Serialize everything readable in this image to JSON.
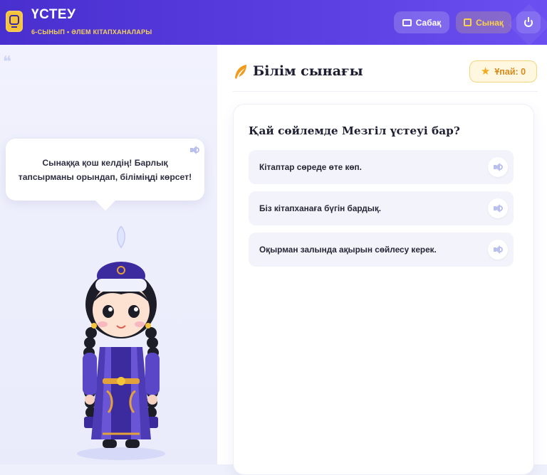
{
  "header": {
    "app_title": "ҮСТЕУ",
    "subtitle": "6-СЫНЫП • ӘЛЕМ КІТАПХАНАЛАРЫ",
    "lesson_button": "Сабақ",
    "test_button": "Сынақ",
    "accent": "#4a2fcf",
    "highlight": "#f4c43a"
  },
  "mascot_speech": {
    "text": "Сынаққа қош келдің! Барлық тапсырманы орындап, біліміңді көрсет!"
  },
  "quiz": {
    "section_title": "Білім сынағы",
    "score_label": "Ұпай: 0",
    "question": "Қай сөйлемде Мезгіл үстеуі бар?",
    "options": [
      {
        "text": "Кітаптар сөреде өте көп."
      },
      {
        "text": "Біз кітапханаға бүгін бардық."
      },
      {
        "text": "Оқырман залында ақырын сөйлесу керек."
      }
    ]
  },
  "icons": {
    "lesson": "classroom-icon",
    "test": "edit-icon",
    "power": "power-icon",
    "audio": "speaker-icon",
    "score": "star-icon",
    "section": "feather-icon"
  }
}
